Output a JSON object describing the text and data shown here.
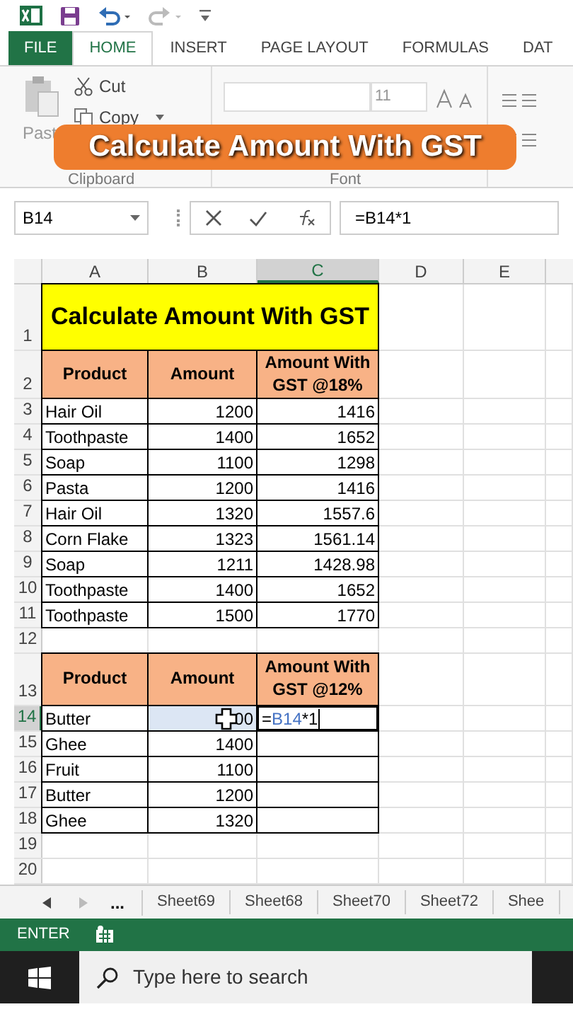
{
  "ribbon_tabs": [
    {
      "label": "FILE",
      "kind": "file",
      "selected": false
    },
    {
      "label": "HOME",
      "kind": "tab",
      "selected": true
    },
    {
      "label": "INSERT",
      "kind": "tab",
      "selected": false
    },
    {
      "label": "PAGE LAYOUT",
      "kind": "tab",
      "selected": false
    },
    {
      "label": "FORMULAS",
      "kind": "tab",
      "selected": false
    },
    {
      "label": "DAT",
      "kind": "tab",
      "selected": false
    }
  ],
  "clipboard": {
    "paste": "Past",
    "cut": "Cut",
    "copy": "Copy",
    "group": "Clipboard"
  },
  "font": {
    "size": "11",
    "group": "Font"
  },
  "banner": "Calculate Amount With GST",
  "name_box": "B14",
  "formula": "=B14*1",
  "columns": [
    {
      "label": "A",
      "selected": false
    },
    {
      "label": "B",
      "selected": false
    },
    {
      "label": "C",
      "selected": true
    },
    {
      "label": "D",
      "selected": false
    },
    {
      "label": "E",
      "selected": false
    }
  ],
  "rows": [
    {
      "number": "1",
      "selected": false,
      "cells": [
        {
          "kind": "title",
          "text": "Calculate Amount With GST"
        }
      ]
    },
    {
      "number": "2",
      "selected": false,
      "cells": [
        {
          "kind": "header",
          "text": "Product"
        },
        {
          "kind": "header",
          "text": "Amount"
        },
        {
          "kind": "header",
          "text": "Amount With GST @18%"
        }
      ]
    },
    {
      "number": "3",
      "selected": false,
      "cells": [
        {
          "kind": "text",
          "text": "Hair Oil"
        },
        {
          "kind": "number",
          "text": "1200"
        },
        {
          "kind": "number",
          "text": "1416"
        }
      ]
    },
    {
      "number": "4",
      "selected": false,
      "cells": [
        {
          "kind": "text",
          "text": "Toothpaste"
        },
        {
          "kind": "number",
          "text": "1400"
        },
        {
          "kind": "number",
          "text": "1652"
        }
      ]
    },
    {
      "number": "5",
      "selected": false,
      "cells": [
        {
          "kind": "text",
          "text": "Soap"
        },
        {
          "kind": "number",
          "text": "1100"
        },
        {
          "kind": "number",
          "text": "1298"
        }
      ]
    },
    {
      "number": "6",
      "selected": false,
      "cells": [
        {
          "kind": "text",
          "text": "Pasta"
        },
        {
          "kind": "number",
          "text": "1200"
        },
        {
          "kind": "number",
          "text": "1416"
        }
      ]
    },
    {
      "number": "7",
      "selected": false,
      "cells": [
        {
          "kind": "text",
          "text": "Hair Oil"
        },
        {
          "kind": "number",
          "text": "1320"
        },
        {
          "kind": "number",
          "text": "1557.6"
        }
      ]
    },
    {
      "number": "8",
      "selected": false,
      "cells": [
        {
          "kind": "text",
          "text": "Corn Flake"
        },
        {
          "kind": "number",
          "text": "1323"
        },
        {
          "kind": "number",
          "text": "1561.14"
        }
      ]
    },
    {
      "number": "9",
      "selected": false,
      "cells": [
        {
          "kind": "text",
          "text": "Soap"
        },
        {
          "kind": "number",
          "text": "1211"
        },
        {
          "kind": "number",
          "text": "1428.98"
        }
      ]
    },
    {
      "number": "10",
      "selected": false,
      "cells": [
        {
          "kind": "text",
          "text": "Toothpaste"
        },
        {
          "kind": "number",
          "text": "1400"
        },
        {
          "kind": "number",
          "text": "1652"
        }
      ]
    },
    {
      "number": "11",
      "selected": false,
      "cells": [
        {
          "kind": "text",
          "text": "Toothpaste"
        },
        {
          "kind": "number",
          "text": "1500"
        },
        {
          "kind": "number",
          "text": "1770"
        }
      ]
    },
    {
      "number": "12",
      "selected": false,
      "cells": []
    },
    {
      "number": "13",
      "selected": false,
      "cells": [
        {
          "kind": "header",
          "text": "Product"
        },
        {
          "kind": "header",
          "text": "Amount"
        },
        {
          "kind": "header",
          "text": "Amount With GST @12%"
        }
      ]
    },
    {
      "number": "14",
      "selected": true,
      "cells": [
        {
          "kind": "text",
          "text": "Butter"
        },
        {
          "kind": "reference",
          "text": "00"
        },
        {
          "kind": "edit",
          "prefix": "=",
          "ref": "B14",
          "suffix": "*1"
        }
      ]
    },
    {
      "number": "15",
      "selected": false,
      "cells": [
        {
          "kind": "text",
          "text": "Ghee"
        },
        {
          "kind": "number",
          "text": "1400"
        },
        {
          "kind": "empty"
        }
      ]
    },
    {
      "number": "16",
      "selected": false,
      "cells": [
        {
          "kind": "text",
          "text": "Fruit"
        },
        {
          "kind": "number",
          "text": "1100"
        },
        {
          "kind": "empty"
        }
      ]
    },
    {
      "number": "17",
      "selected": false,
      "cells": [
        {
          "kind": "text",
          "text": "Butter"
        },
        {
          "kind": "number",
          "text": "1200"
        },
        {
          "kind": "empty"
        }
      ]
    },
    {
      "number": "18",
      "selected": false,
      "cells": [
        {
          "kind": "text",
          "text": "Ghee"
        },
        {
          "kind": "number",
          "text": "1320"
        },
        {
          "kind": "empty"
        }
      ]
    },
    {
      "number": "19",
      "selected": false,
      "cells": []
    },
    {
      "number": "20",
      "selected": false,
      "cells": []
    }
  ],
  "sheet_tabs": [
    {
      "label": "...",
      "kind": "more"
    },
    {
      "label": "Sheet69",
      "kind": "sheet"
    },
    {
      "label": "Sheet68",
      "kind": "sheet"
    },
    {
      "label": "Sheet70",
      "kind": "sheet"
    },
    {
      "label": "Sheet72",
      "kind": "sheet"
    },
    {
      "label": "Shee",
      "kind": "sheet"
    }
  ],
  "status_bar": {
    "mode": "ENTER"
  },
  "taskbar": {
    "search_placeholder": "Type here to search"
  }
}
